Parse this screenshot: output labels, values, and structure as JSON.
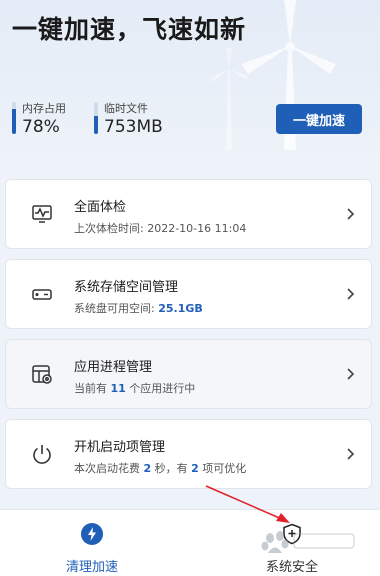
{
  "hero": {
    "title": "一键加速，飞速如新",
    "memory": {
      "label": "内存占用",
      "value": "78%",
      "fraction": 0.78
    },
    "temp_files": {
      "label": "临时文件",
      "value": "753MB",
      "fraction": 0.55
    },
    "accelerate_label": "一键加速"
  },
  "cards": [
    {
      "title": "全面体检",
      "sub_prefix": "上次体检时间: 2022-10-16 11:04",
      "icon": "monitor-pulse-icon"
    },
    {
      "title": "系统存储空间管理",
      "sub_prefix": "系统盘可用空间: ",
      "sub_value": "25.1GB",
      "icon": "drive-icon"
    },
    {
      "title": "应用进程管理",
      "sub_prefix": "当前有 ",
      "sub_value": "11",
      "sub_suffix": " 个应用进行中",
      "icon": "app-process-icon"
    },
    {
      "title": "开机启动项管理",
      "sub_prefix": "本次启动花费 ",
      "sub_value": "2",
      "sub_mid": " 秒，有 ",
      "sub_value2": "2",
      "sub_suffix": " 项可优化",
      "icon": "power-icon"
    }
  ],
  "nav": {
    "clean_label": "清理加速",
    "security_label": "系统安全"
  },
  "colors": {
    "accent": "#1f5fb8",
    "annotation_arrow": "#e0202a"
  }
}
